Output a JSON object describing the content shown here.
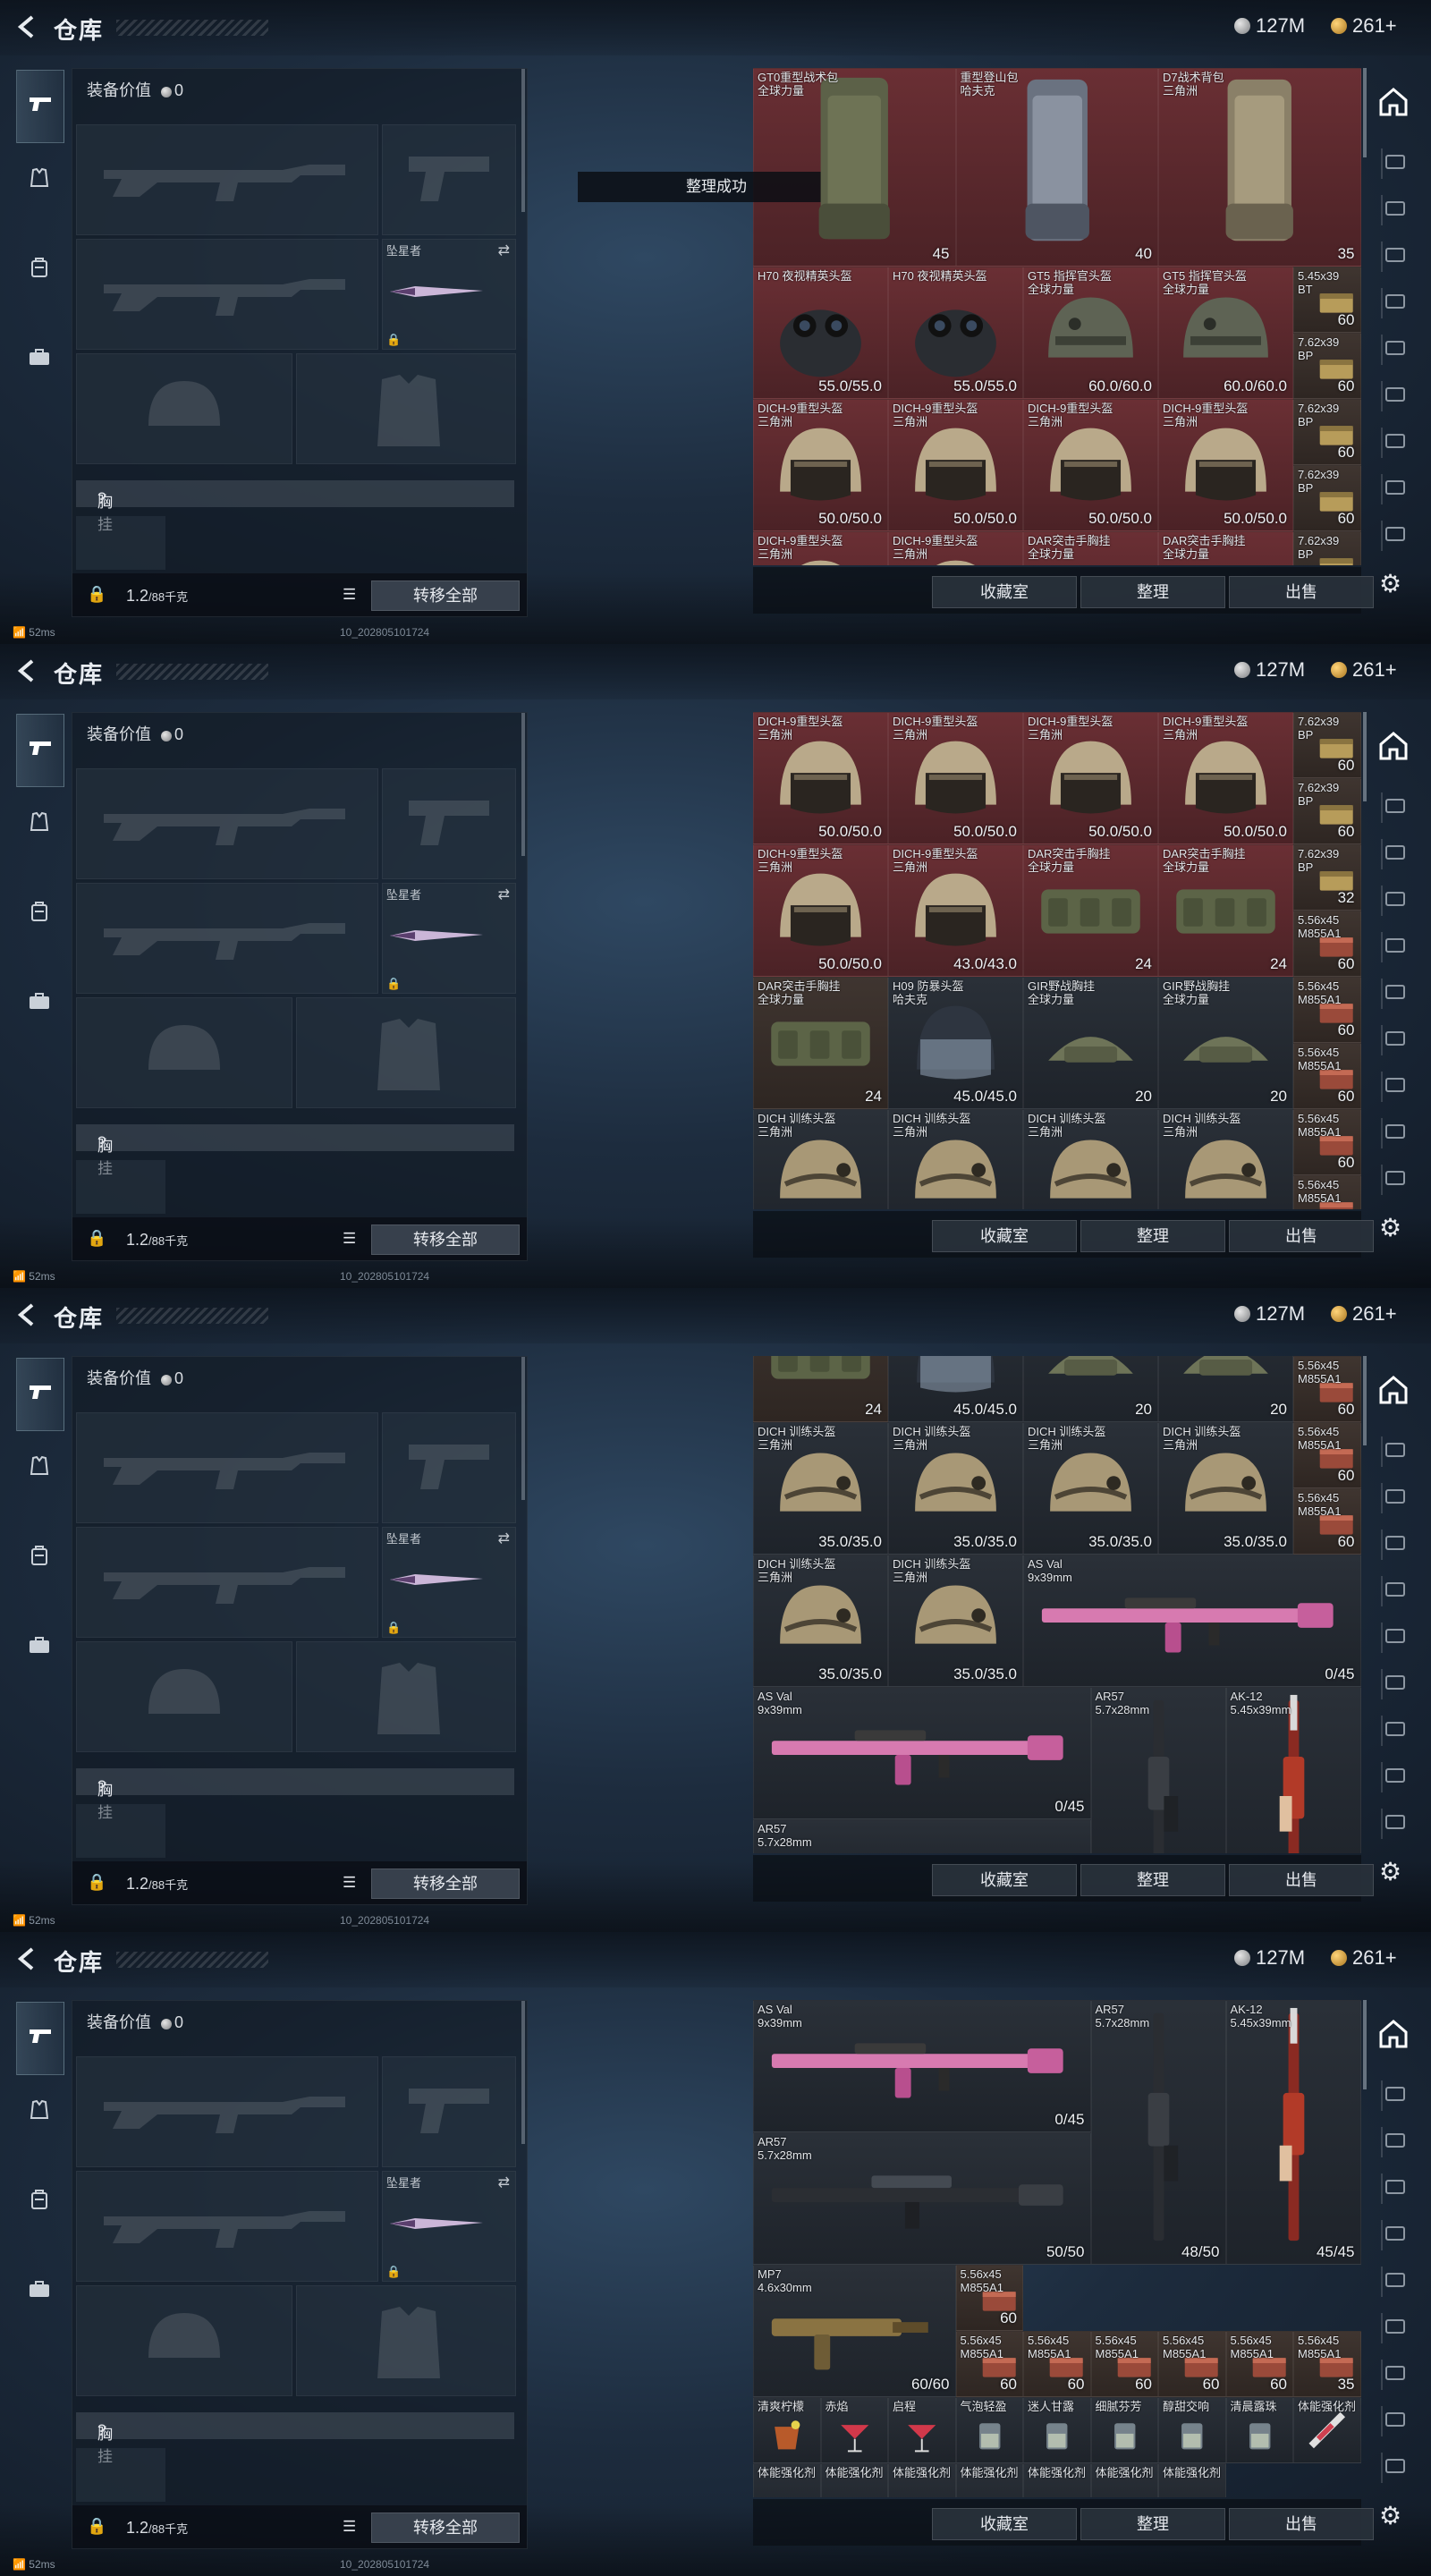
{
  "app": {
    "title": "仓库",
    "back_icon": "back-arrow-icon"
  },
  "currency": {
    "silver": "127M",
    "gold": "261+"
  },
  "left_panel": {
    "value_label": "装备价值",
    "value": "0",
    "knife_label": "坠星者",
    "rig_label": "胸挂",
    "rig_hint": "?",
    "weight": "1.2",
    "weight_max": "/88千克",
    "transfer_all": "转移全部"
  },
  "status": {
    "ping": "52ms",
    "build": "10_2028051017​24"
  },
  "footer_buttons": {
    "collection": "收藏室",
    "sort": "整理",
    "sell": "出售"
  },
  "toast": "整理成功",
  "panes": [
    {
      "cells": [
        {
          "name": "GT0重型战术包\n全球力量",
          "val": "45",
          "kind": "bag",
          "color": "red",
          "c": 0,
          "r": 0,
          "w": 3,
          "h": 3
        },
        {
          "name": "重型登山包\n哈夫克",
          "val": "40",
          "kind": "bag2",
          "color": "red",
          "c": 3,
          "r": 0,
          "w": 3,
          "h": 3
        },
        {
          "name": "D7战术背包\n三角洲",
          "val": "35",
          "kind": "bag3",
          "color": "red",
          "c": 6,
          "r": 0,
          "w": 3,
          "h": 3
        },
        {
          "name": "H70 夜视精英头盔",
          "val": "55.0/55.0",
          "kind": "nvg",
          "color": "red",
          "c": 0,
          "r": 3,
          "w": 2,
          "h": 2
        },
        {
          "name": "H70 夜视精英头盔",
          "val": "55.0/55.0",
          "kind": "nvg",
          "color": "red",
          "c": 2,
          "r": 3,
          "w": 2,
          "h": 2
        },
        {
          "name": "GT5 指挥官头盔\n全球力量",
          "val": "60.0/60.0",
          "kind": "helmet",
          "color": "red",
          "c": 4,
          "r": 3,
          "w": 2,
          "h": 2
        },
        {
          "name": "GT5 指挥官头盔\n全球力量",
          "val": "60.0/60.0",
          "kind": "helmet",
          "color": "red",
          "c": 6,
          "r": 3,
          "w": 2,
          "h": 2
        },
        {
          "name": "5.45x39\nBT",
          "val": "60",
          "kind": "ammo",
          "color": "brown",
          "c": 8,
          "r": 3,
          "w": 1,
          "h": 1
        },
        {
          "name": "7.62x39\nBP",
          "val": "60",
          "kind": "ammo",
          "color": "brown",
          "c": 8,
          "r": 4,
          "w": 1,
          "h": 1
        },
        {
          "name": "DICH-9重型头盔\n三角洲",
          "val": "50.0/50.0",
          "kind": "face",
          "color": "red",
          "c": 0,
          "r": 5,
          "w": 2,
          "h": 2
        },
        {
          "name": "DICH-9重型头盔\n三角洲",
          "val": "50.0/50.0",
          "kind": "face",
          "color": "red",
          "c": 2,
          "r": 5,
          "w": 2,
          "h": 2
        },
        {
          "name": "DICH-9重型头盔\n三角洲",
          "val": "50.0/50.0",
          "kind": "face",
          "color": "red",
          "c": 4,
          "r": 5,
          "w": 2,
          "h": 2
        },
        {
          "name": "DICH-9重型头盔\n三角洲",
          "val": "50.0/50.0",
          "kind": "face",
          "color": "red",
          "c": 6,
          "r": 5,
          "w": 2,
          "h": 2
        },
        {
          "name": "7.62x39\nBP",
          "val": "60",
          "kind": "ammo",
          "color": "brown",
          "c": 8,
          "r": 5,
          "w": 1,
          "h": 1
        },
        {
          "name": "7.62x39\nBP",
          "val": "60",
          "kind": "ammo",
          "color": "brown",
          "c": 8,
          "r": 6,
          "w": 1,
          "h": 1
        },
        {
          "name": "DICH-9重型头盔\n三角洲",
          "val": "",
          "kind": "face",
          "color": "red",
          "c": 0,
          "r": 7,
          "w": 2,
          "h": 2
        },
        {
          "name": "DICH-9重型头盔\n三角洲",
          "val": "",
          "kind": "face",
          "color": "red",
          "c": 2,
          "r": 7,
          "w": 2,
          "h": 2
        },
        {
          "name": "DAR突击手胸挂\n全球力量",
          "val": "",
          "kind": "rig",
          "color": "red",
          "c": 4,
          "r": 7,
          "w": 2,
          "h": 2
        },
        {
          "name": "DAR突击手胸挂\n全球力量",
          "val": "",
          "kind": "rig",
          "color": "red",
          "c": 6,
          "r": 7,
          "w": 2,
          "h": 2
        },
        {
          "name": "7.62x39\nBP",
          "val": "",
          "kind": "ammo",
          "color": "brown",
          "c": 8,
          "r": 7,
          "w": 1,
          "h": 1
        }
      ]
    },
    {
      "cells": [
        {
          "name": "DICH-9重型头盔\n三角洲",
          "val": "50.0/50.0",
          "kind": "face",
          "color": "red",
          "c": 0,
          "r": 0,
          "w": 2,
          "h": 2
        },
        {
          "name": "DICH-9重型头盔\n三角洲",
          "val": "50.0/50.0",
          "kind": "face",
          "color": "red",
          "c": 2,
          "r": 0,
          "w": 2,
          "h": 2
        },
        {
          "name": "DICH-9重型头盔\n三角洲",
          "val": "50.0/50.0",
          "kind": "face",
          "color": "red",
          "c": 4,
          "r": 0,
          "w": 2,
          "h": 2
        },
        {
          "name": "DICH-9重型头盔\n三角洲",
          "val": "50.0/50.0",
          "kind": "face",
          "color": "red",
          "c": 6,
          "r": 0,
          "w": 2,
          "h": 2
        },
        {
          "name": "7.62x39\nBP",
          "val": "60",
          "kind": "ammo",
          "color": "brown",
          "c": 8,
          "r": 0,
          "w": 1,
          "h": 1
        },
        {
          "name": "7.62x39\nBP",
          "val": "60",
          "kind": "ammo",
          "color": "brown",
          "c": 8,
          "r": 1,
          "w": 1,
          "h": 1
        },
        {
          "name": "DICH-9重型头盔\n三角洲",
          "val": "50.0/50.0",
          "kind": "face",
          "color": "red",
          "c": 0,
          "r": 2,
          "w": 2,
          "h": 2
        },
        {
          "name": "DICH-9重型头盔\n三角洲",
          "val": "43.0/43.0",
          "kind": "face",
          "color": "red",
          "c": 2,
          "r": 2,
          "w": 2,
          "h": 2
        },
        {
          "name": "DAR突击手胸挂\n全球力量",
          "val": "24",
          "kind": "rig",
          "color": "red",
          "c": 4,
          "r": 2,
          "w": 2,
          "h": 2
        },
        {
          "name": "DAR突击手胸挂\n全球力量",
          "val": "24",
          "kind": "rig",
          "color": "red",
          "c": 6,
          "r": 2,
          "w": 2,
          "h": 2
        },
        {
          "name": "7.62x39\nBP",
          "val": "32",
          "kind": "ammo",
          "color": "brown",
          "c": 8,
          "r": 2,
          "w": 1,
          "h": 1
        },
        {
          "name": "5.56x45\nM855A1",
          "val": "60",
          "kind": "ammo2",
          "color": "brown",
          "c": 8,
          "r": 3,
          "w": 1,
          "h": 1
        },
        {
          "name": "DAR突击手胸挂\n全球力量",
          "val": "24",
          "kind": "rig",
          "color": "brown",
          "c": 0,
          "r": 4,
          "w": 2,
          "h": 2
        },
        {
          "name": "H09 防暴头盔\n哈夫克",
          "val": "45.0/45.0",
          "kind": "riot",
          "color": "dark",
          "c": 2,
          "r": 4,
          "w": 2,
          "h": 2
        },
        {
          "name": "GIR野战胸挂\n全球力量",
          "val": "20",
          "kind": "rig2",
          "color": "dark",
          "c": 4,
          "r": 4,
          "w": 2,
          "h": 2
        },
        {
          "name": "GIR野战胸挂\n全球力量",
          "val": "20",
          "kind": "rig2",
          "color": "dark",
          "c": 6,
          "r": 4,
          "w": 2,
          "h": 2
        },
        {
          "name": "5.56x45\nM855A1",
          "val": "60",
          "kind": "ammo2",
          "color": "brown",
          "c": 8,
          "r": 4,
          "w": 1,
          "h": 1
        },
        {
          "name": "5.56x45\nM855A1",
          "val": "60",
          "kind": "ammo2",
          "color": "brown",
          "c": 8,
          "r": 5,
          "w": 1,
          "h": 1
        },
        {
          "name": "DICH 训练头盔\n三角洲",
          "val": "",
          "kind": "train",
          "color": "dark",
          "c": 0,
          "r": 6,
          "w": 2,
          "h": 2
        },
        {
          "name": "DICH 训练头盔\n三角洲",
          "val": "",
          "kind": "train",
          "color": "dark",
          "c": 2,
          "r": 6,
          "w": 2,
          "h": 2
        },
        {
          "name": "DICH 训练头盔\n三角洲",
          "val": "",
          "kind": "train",
          "color": "dark",
          "c": 4,
          "r": 6,
          "w": 2,
          "h": 2
        },
        {
          "name": "DICH 训练头盔\n三角洲",
          "val": "",
          "kind": "train",
          "color": "dark",
          "c": 6,
          "r": 6,
          "w": 2,
          "h": 2
        },
        {
          "name": "5.56x45\nM855A1",
          "val": "60",
          "kind": "ammo2",
          "color": "brown",
          "c": 8,
          "r": 6,
          "w": 1,
          "h": 1
        },
        {
          "name": "5.56x45\nM855A1",
          "val": "",
          "kind": "ammo2",
          "color": "brown",
          "c": 8,
          "r": 7,
          "w": 1,
          "h": 1
        }
      ]
    },
    {
      "cells": [
        {
          "name": "",
          "val": "24",
          "kind": "rig",
          "color": "brown",
          "c": 0,
          "r": -1,
          "w": 2,
          "h": 2
        },
        {
          "name": "",
          "val": "45.0/45.0",
          "kind": "riot",
          "color": "dark",
          "c": 2,
          "r": -1,
          "w": 2,
          "h": 2
        },
        {
          "name": "",
          "val": "20",
          "kind": "rig2",
          "color": "dark",
          "c": 4,
          "r": -1,
          "w": 2,
          "h": 2
        },
        {
          "name": "",
          "val": "20",
          "kind": "rig2",
          "color": "dark",
          "c": 6,
          "r": -1,
          "w": 2,
          "h": 2
        },
        {
          "name": "5.56x45\nM855A1",
          "val": "60",
          "kind": "ammo2",
          "color": "brown",
          "c": 8,
          "r": 0,
          "w": 1,
          "h": 1
        },
        {
          "name": "DICH 训练头盔\n三角洲",
          "val": "35.0/35.0",
          "kind": "train",
          "color": "dark",
          "c": 0,
          "r": 1,
          "w": 2,
          "h": 2
        },
        {
          "name": "DICH 训练头盔\n三角洲",
          "val": "35.0/35.0",
          "kind": "train",
          "color": "dark",
          "c": 2,
          "r": 1,
          "w": 2,
          "h": 2
        },
        {
          "name": "DICH 训练头盔\n三角洲",
          "val": "35.0/35.0",
          "kind": "train",
          "color": "dark",
          "c": 4,
          "r": 1,
          "w": 2,
          "h": 2
        },
        {
          "name": "DICH 训练头盔\n三角洲",
          "val": "35.0/35.0",
          "kind": "train",
          "color": "dark",
          "c": 6,
          "r": 1,
          "w": 2,
          "h": 2
        },
        {
          "name": "5.56x45\nM855A1",
          "val": "60",
          "kind": "ammo2",
          "color": "brown",
          "c": 8,
          "r": 1,
          "w": 1,
          "h": 1
        },
        {
          "name": "5.56x45\nM855A1",
          "val": "60",
          "kind": "ammo2",
          "color": "brown",
          "c": 8,
          "r": 2,
          "w": 1,
          "h": 1
        },
        {
          "name": "DICH 训练头盔\n三角洲",
          "val": "35.0/35.0",
          "kind": "train",
          "color": "dark",
          "c": 0,
          "r": 3,
          "w": 2,
          "h": 2
        },
        {
          "name": "DICH 训练头盔\n三角洲",
          "val": "35.0/35.0",
          "kind": "train",
          "color": "dark",
          "c": 2,
          "r": 3,
          "w": 2,
          "h": 2
        },
        {
          "name": "AS Val\n9x39mm",
          "val": "0/45",
          "kind": "pinkgun",
          "color": "dark",
          "c": 4,
          "r": 3,
          "w": 5,
          "h": 2
        },
        {
          "name": "AS Val\n9x39mm",
          "val": "0/45",
          "kind": "pinkgun",
          "color": "dark",
          "c": 0,
          "r": 5,
          "w": 5,
          "h": 2
        },
        {
          "name": "AR57\n5.7x28mm",
          "val": "",
          "kind": "vgun",
          "color": "dark",
          "c": 5,
          "r": 5,
          "w": 2,
          "h": 3
        },
        {
          "name": "AK-12\n5.45x39mm",
          "val": "",
          "kind": "vgun2",
          "color": "dark",
          "c": 7,
          "r": 5,
          "w": 2,
          "h": 3
        },
        {
          "name": "AR57\n5.7x28mm",
          "val": "",
          "kind": "none",
          "color": "dark",
          "c": 0,
          "r": 7,
          "w": 5,
          "h": 1
        }
      ]
    },
    {
      "cells": [
        {
          "name": "AS Val\n9x39mm",
          "val": "0/45",
          "kind": "pinkgun",
          "color": "dark",
          "c": 0,
          "r": 0,
          "w": 5,
          "h": 2
        },
        {
          "name": "AR57\n5.7x28mm",
          "val": "48/50",
          "kind": "vgun",
          "color": "dark",
          "c": 5,
          "r": 0,
          "w": 2,
          "h": 4
        },
        {
          "name": "AK-12\n5.45x39mm",
          "val": "45/45",
          "kind": "vgun2",
          "color": "dark",
          "c": 7,
          "r": 0,
          "w": 2,
          "h": 4
        },
        {
          "name": "AR57\n5.7x28mm",
          "val": "50/50",
          "kind": "blackgun",
          "color": "dark",
          "c": 0,
          "r": 2,
          "w": 5,
          "h": 2
        },
        {
          "name": "MP7\n4.6x30mm",
          "val": "60/60",
          "kind": "smg",
          "color": "dark",
          "c": 0,
          "r": 4,
          "w": 3,
          "h": 2
        },
        {
          "name": "5.56x45\nM855A1",
          "val": "60",
          "kind": "ammo2",
          "color": "brown",
          "c": 3,
          "r": 4,
          "w": 1,
          "h": 1
        },
        {
          "name": "5.56x45\nM855A1",
          "val": "60",
          "kind": "ammo2",
          "color": "brown",
          "c": 3,
          "r": 5,
          "w": 1,
          "h": 1
        },
        {
          "name": "5.56x45\nM855A1",
          "val": "60",
          "kind": "ammo2",
          "color": "brown",
          "c": 4,
          "r": 5,
          "w": 1,
          "h": 1
        },
        {
          "name": "5.56x45\nM855A1",
          "val": "60",
          "kind": "ammo2",
          "color": "brown",
          "c": 5,
          "r": 5,
          "w": 1,
          "h": 1
        },
        {
          "name": "5.56x45\nM855A1",
          "val": "60",
          "kind": "ammo2",
          "color": "brown",
          "c": 6,
          "r": 5,
          "w": 1,
          "h": 1
        },
        {
          "name": "5.56x45\nM855A1",
          "val": "60",
          "kind": "ammo2",
          "color": "brown",
          "c": 7,
          "r": 5,
          "w": 1,
          "h": 1
        },
        {
          "name": "5.56x45\nM855A1",
          "val": "35",
          "kind": "ammo2",
          "color": "brown",
          "c": 8,
          "r": 5,
          "w": 1,
          "h": 1
        },
        {
          "name": "清爽柠檬",
          "val": "",
          "kind": "drink",
          "color": "dark",
          "c": 0,
          "r": 6,
          "w": 1,
          "h": 1
        },
        {
          "name": "赤焰",
          "val": "",
          "kind": "cocktail",
          "color": "dark",
          "c": 1,
          "r": 6,
          "w": 1,
          "h": 1
        },
        {
          "name": "启程",
          "val": "",
          "kind": "cocktail",
          "color": "dark",
          "c": 2,
          "r": 6,
          "w": 1,
          "h": 1
        },
        {
          "name": "气泡轻盈",
          "val": "",
          "kind": "glass",
          "color": "dark",
          "c": 3,
          "r": 6,
          "w": 1,
          "h": 1
        },
        {
          "name": "迷人甘露",
          "val": "",
          "kind": "glass",
          "color": "dark",
          "c": 4,
          "r": 6,
          "w": 1,
          "h": 1
        },
        {
          "name": "细腻芬芳",
          "val": "",
          "kind": "glass",
          "color": "dark",
          "c": 5,
          "r": 6,
          "w": 1,
          "h": 1
        },
        {
          "name": "醇甜交响",
          "val": "",
          "kind": "glass",
          "color": "dark",
          "c": 6,
          "r": 6,
          "w": 1,
          "h": 1
        },
        {
          "name": "清晨露珠",
          "val": "",
          "kind": "glass",
          "color": "dark",
          "c": 7,
          "r": 6,
          "w": 1,
          "h": 1
        },
        {
          "name": "体能强化剂",
          "val": "",
          "kind": "syringe",
          "color": "dark",
          "c": 8,
          "r": 6,
          "w": 1,
          "h": 1
        },
        {
          "name": "体能强化剂",
          "val": "",
          "kind": "none",
          "color": "dark",
          "c": 0,
          "r": 7,
          "w": 1,
          "h": 1
        },
        {
          "name": "体能强化剂",
          "val": "",
          "kind": "none",
          "color": "dark",
          "c": 1,
          "r": 7,
          "w": 1,
          "h": 1
        },
        {
          "name": "体能强化剂",
          "val": "",
          "kind": "none",
          "color": "dark",
          "c": 2,
          "r": 7,
          "w": 1,
          "h": 1
        },
        {
          "name": "体能强化剂",
          "val": "",
          "kind": "none",
          "color": "dark",
          "c": 3,
          "r": 7,
          "w": 1,
          "h": 1
        },
        {
          "name": "体能强化剂",
          "val": "",
          "kind": "none",
          "color": "dark",
          "c": 4,
          "r": 7,
          "w": 1,
          "h": 1
        },
        {
          "name": "体能强化剂",
          "val": "",
          "kind": "none",
          "color": "dark",
          "c": 5,
          "r": 7,
          "w": 1,
          "h": 1
        },
        {
          "name": "体能强化剂",
          "val": "",
          "kind": "none",
          "color": "dark",
          "c": 6,
          "r": 7,
          "w": 1,
          "h": 1
        }
      ]
    }
  ]
}
